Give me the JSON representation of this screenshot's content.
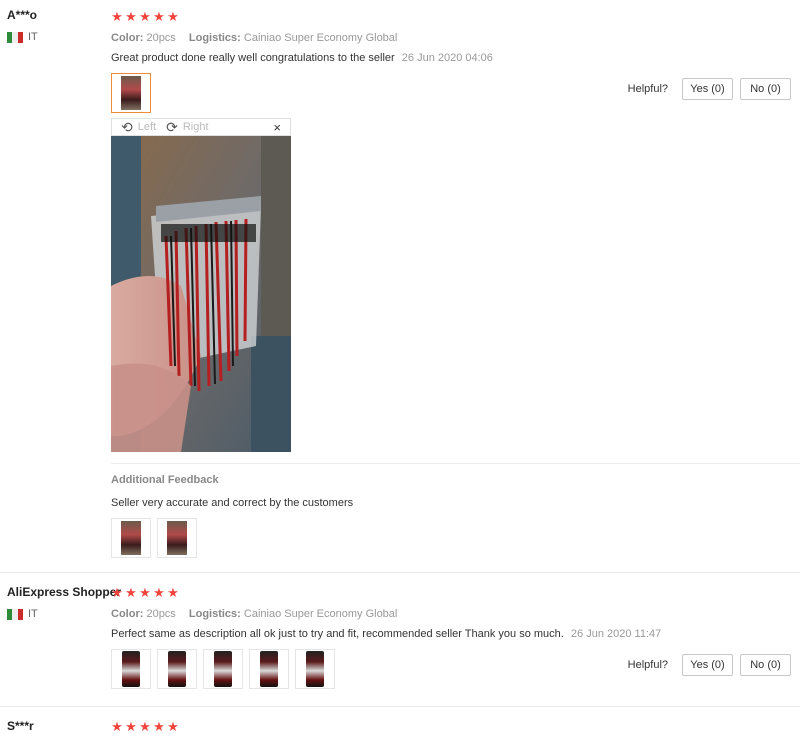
{
  "reviews": [
    {
      "user": "A***o",
      "country": "IT",
      "stars": 5,
      "color_label": "Color:",
      "color_value": "20pcs",
      "logistics_label": "Logistics:",
      "logistics_value": "Cainiao Super Economy Global",
      "text": "Great product done really well congratulations to the seller",
      "date": "26 Jun 2020 04:06",
      "helpful_label": "Helpful?",
      "yes_label": "Yes (0)",
      "no_label": "No (0)",
      "viewer": {
        "left_label": "Left",
        "right_label": "Right",
        "close_icon": "×"
      },
      "additional_title": "Additional Feedback",
      "additional_text": "Seller very accurate and correct by the customers"
    },
    {
      "user": "AliExpress Shopper",
      "country": "IT",
      "stars": 5,
      "color_label": "Color:",
      "color_value": "20pcs",
      "logistics_label": "Logistics:",
      "logistics_value": "Cainiao Super Economy Global",
      "text": "Perfect same as description all ok just to try and fit, recommended seller Thank you so much.",
      "date": "26 Jun 2020 11:47",
      "helpful_label": "Helpful?",
      "yes_label": "Yes (0)",
      "no_label": "No (0)"
    },
    {
      "user": "S***r",
      "stars": 5
    }
  ],
  "colors": {
    "star": "#f0443c",
    "active_thumb_border": "#f08c3a",
    "flag_it": [
      "#2e8b3a",
      "#eeeeee",
      "#cc2b2b"
    ]
  },
  "icons": {
    "star": "star-icon",
    "rotate_left": "rotate-left-icon",
    "rotate_right": "rotate-right-icon",
    "close": "close-icon",
    "flag": "italy-flag-icon"
  }
}
